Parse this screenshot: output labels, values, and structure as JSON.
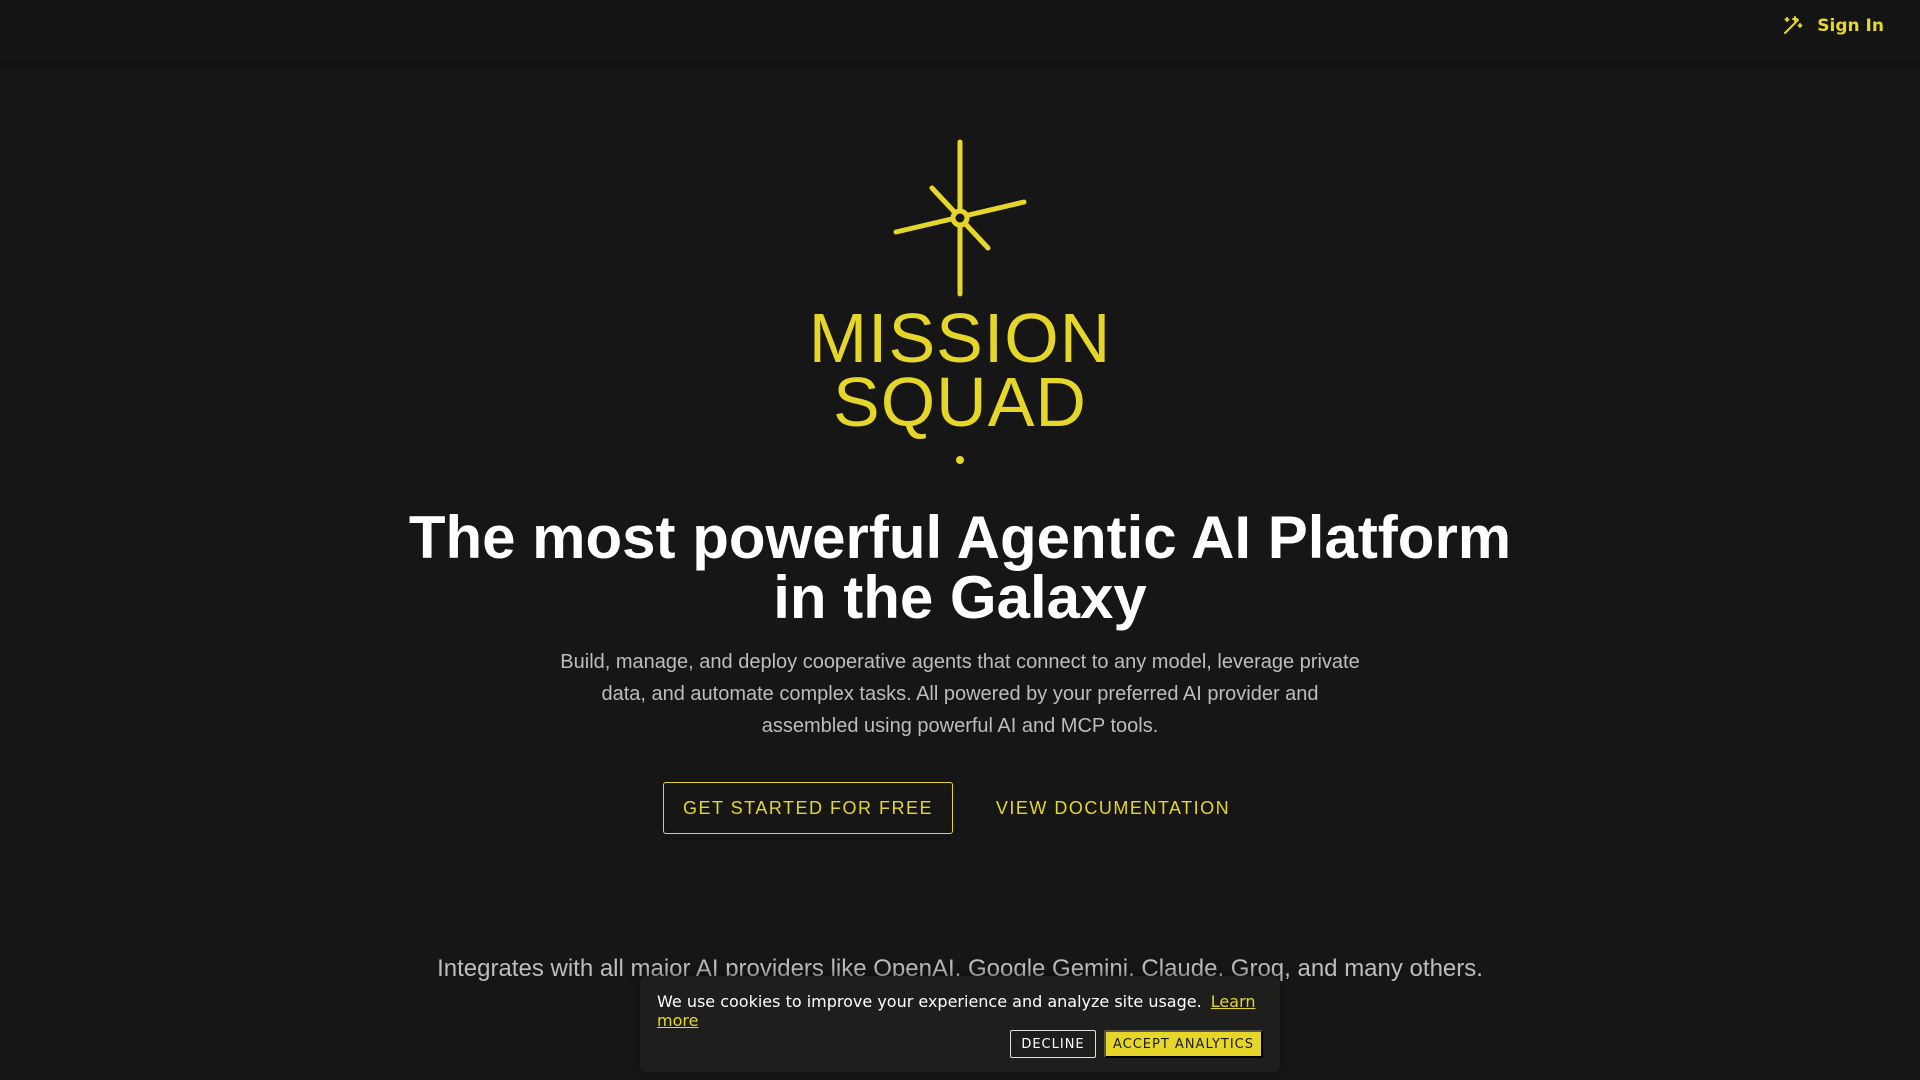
{
  "header": {
    "theme_toggle_icon": "theme-toggle-icon",
    "sign_in_label": "Sign In"
  },
  "brand": {
    "logo_icon": "star-compass-logo-icon",
    "wordmark_line1": "MISSION",
    "wordmark_line2": "SQUAD",
    "accent_color": "#e6d62a"
  },
  "hero": {
    "headline_line1": "The most powerful Agentic AI Platform",
    "headline_line2": "in the Galaxy",
    "subtext": "Build, manage, and deploy cooperative agents that connect to any model, leverage private data, and automate complex tasks. All powered by your preferred AI provider and assembled using powerful AI and MCP tools.",
    "primary_cta": "GET STARTED FOR FREE",
    "secondary_cta": "VIEW DOCUMENTATION"
  },
  "integrations": {
    "text": "Integrates with all major AI providers like OpenAI, Google Gemini, Claude, Groq, and many others."
  },
  "cookie_banner": {
    "message": "We use cookies to improve your experience and analyze site usage.",
    "learn_more": "Learn more",
    "decline_label": "DECLINE",
    "accept_label": "ACCEPT ANALYTICS"
  },
  "colors": {
    "background": "#161616",
    "accent": "#e6d62a",
    "text_primary": "#ffffff",
    "text_secondary": "#bdbdbd"
  }
}
